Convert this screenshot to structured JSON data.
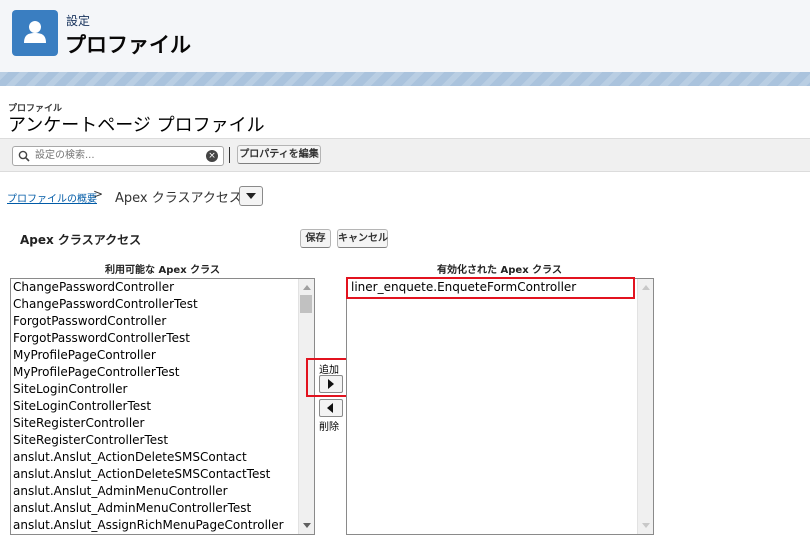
{
  "header": {
    "subtitle": "設定",
    "title": "プロファイル"
  },
  "page": {
    "section_label": "プロファイル",
    "title": "アンケートページ プロファイル"
  },
  "toolbar": {
    "search_placeholder": "設定の検索...",
    "edit_properties_label": "プロパティを編集"
  },
  "breadcrumb": {
    "link": "プロファイルの概要",
    "separator": ">",
    "current": "Apex クラスアクセス"
  },
  "section": {
    "title": "Apex クラスアクセス",
    "save_label": "保存",
    "cancel_label": "キャンセル"
  },
  "available": {
    "header": "利用可能な Apex クラス",
    "items": [
      "ChangePasswordController",
      "ChangePasswordControllerTest",
      "ForgotPasswordController",
      "ForgotPasswordControllerTest",
      "MyProfilePageController",
      "MyProfilePageControllerTest",
      "SiteLoginController",
      "SiteLoginControllerTest",
      "SiteRegisterController",
      "SiteRegisterControllerTest",
      "anslut.Anslut_ActionDeleteSMSContact",
      "anslut.Anslut_ActionDeleteSMSContactTest",
      "anslut.Anslut_AdminMenuController",
      "anslut.Anslut_AdminMenuControllerTest",
      "anslut.Anslut_AssignRichMenuPageController"
    ]
  },
  "enabled": {
    "header": "有効化された Apex クラス",
    "items": [
      "liner_enquete.EnqueteFormController"
    ]
  },
  "transfer": {
    "add_label": "追加",
    "remove_label": "削除"
  },
  "colors": {
    "highlight": "#e2131f",
    "header_icon": "#3a7ec1",
    "link": "#015ba7"
  }
}
